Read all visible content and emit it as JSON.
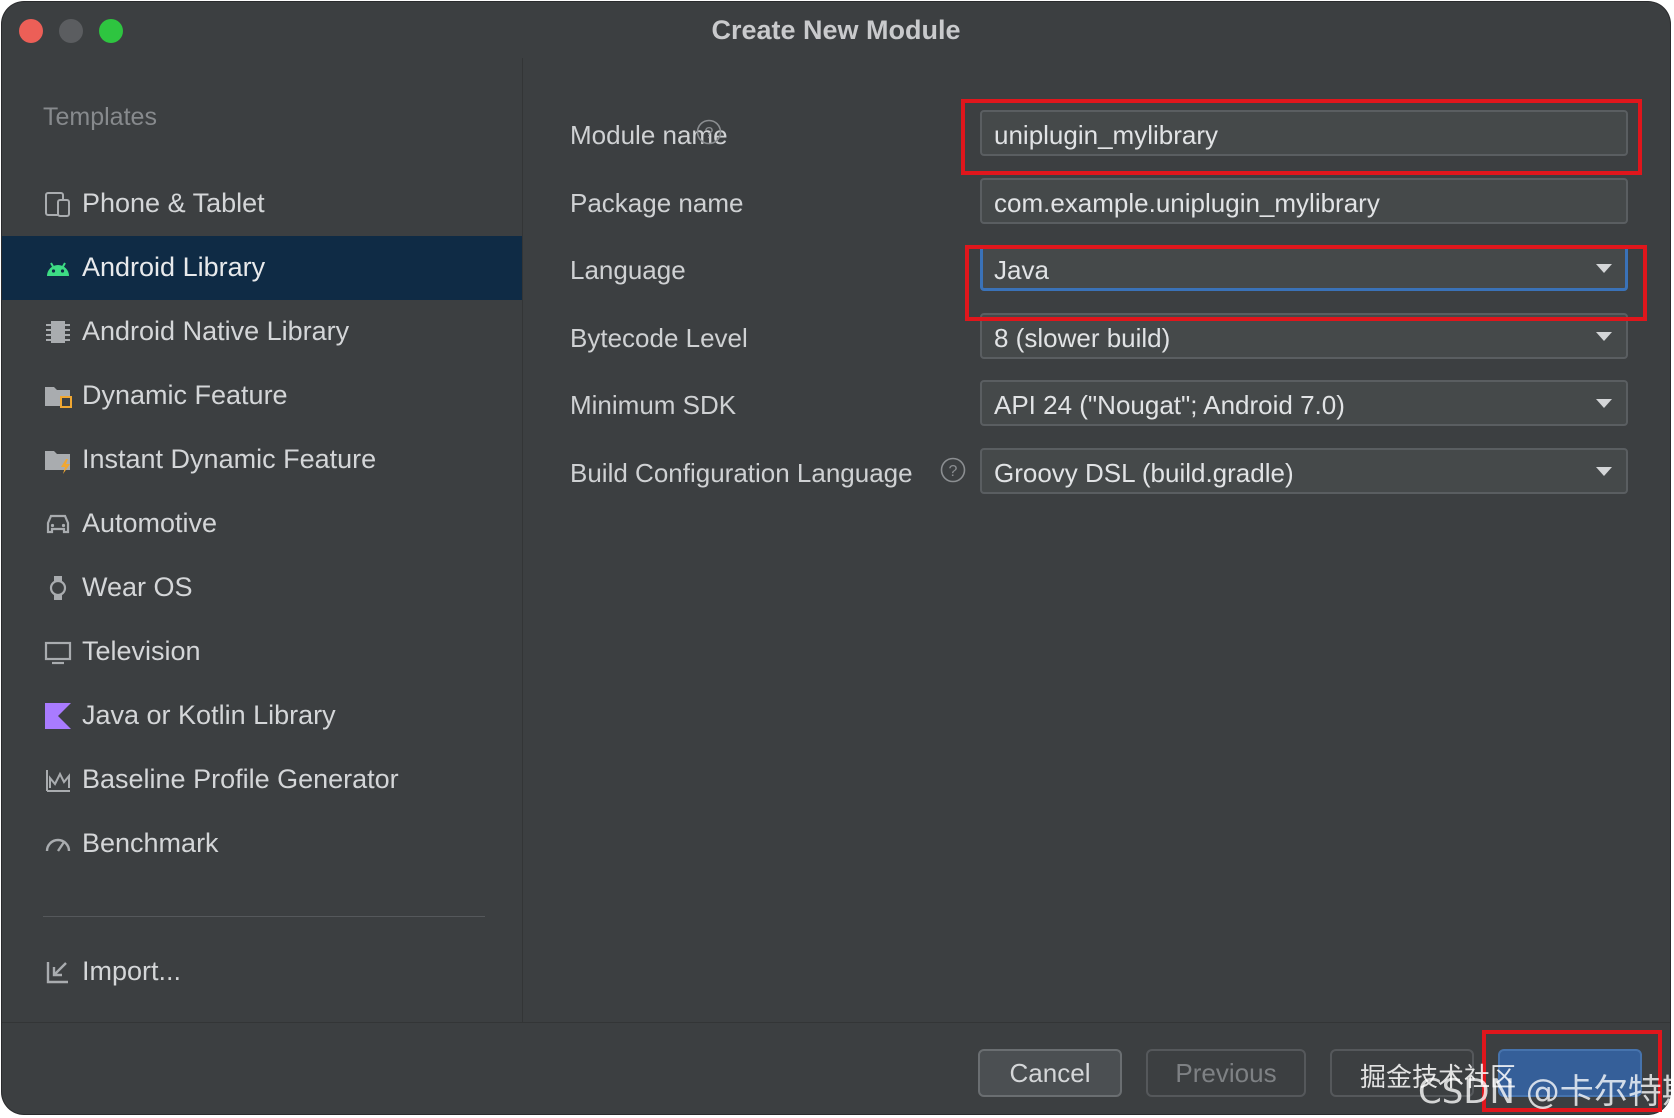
{
  "window": {
    "title": "Create New Module"
  },
  "sidebar": {
    "section_label": "Templates",
    "items": [
      {
        "label": "Phone & Tablet",
        "icon": "phone-tablet-icon",
        "selected": false
      },
      {
        "label": "Android Library",
        "icon": "android-icon",
        "selected": true
      },
      {
        "label": "Android Native Library",
        "icon": "chip-icon",
        "selected": false
      },
      {
        "label": "Dynamic Feature",
        "icon": "folder-feature-icon",
        "selected": false
      },
      {
        "label": "Instant Dynamic Feature",
        "icon": "folder-instant-icon",
        "selected": false
      },
      {
        "label": "Automotive",
        "icon": "car-icon",
        "selected": false
      },
      {
        "label": "Wear OS",
        "icon": "watch-icon",
        "selected": false
      },
      {
        "label": "Television",
        "icon": "tv-icon",
        "selected": false
      },
      {
        "label": "Java or Kotlin Library",
        "icon": "kotlin-icon",
        "selected": false
      },
      {
        "label": "Baseline Profile Generator",
        "icon": "chart-icon",
        "selected": false
      },
      {
        "label": "Benchmark",
        "icon": "gauge-icon",
        "selected": false
      }
    ],
    "import_label": "Import..."
  },
  "form": {
    "module_name": {
      "label": "Module name",
      "value": "uniplugin_mylibrary"
    },
    "package_name": {
      "label": "Package name",
      "value": "com.example.uniplugin_mylibrary"
    },
    "language": {
      "label": "Language",
      "value": "Java"
    },
    "bytecode_level": {
      "label": "Bytecode Level",
      "value": "8 (slower build)"
    },
    "minimum_sdk": {
      "label": "Minimum SDK",
      "value": "API 24 (\"Nougat\"; Android 7.0)"
    },
    "build_config_language": {
      "label": "Build Configuration Language",
      "value": "Groovy DSL (build.gradle)"
    }
  },
  "footer": {
    "cancel_label": "Cancel",
    "previous_label": "Previous",
    "next_label": "",
    "finish_label": ""
  },
  "watermarks": {
    "juejin": "掘金技术社区",
    "csdn": "CSDN @卡尔特斯"
  },
  "colors": {
    "window_bg": "#3c3f41",
    "selected_bg": "#0f2b45",
    "highlight": "#e0161c",
    "focus_border": "#3a72b8",
    "android_green": "#3ddc84",
    "kotlin_purple": "#a97bff"
  }
}
